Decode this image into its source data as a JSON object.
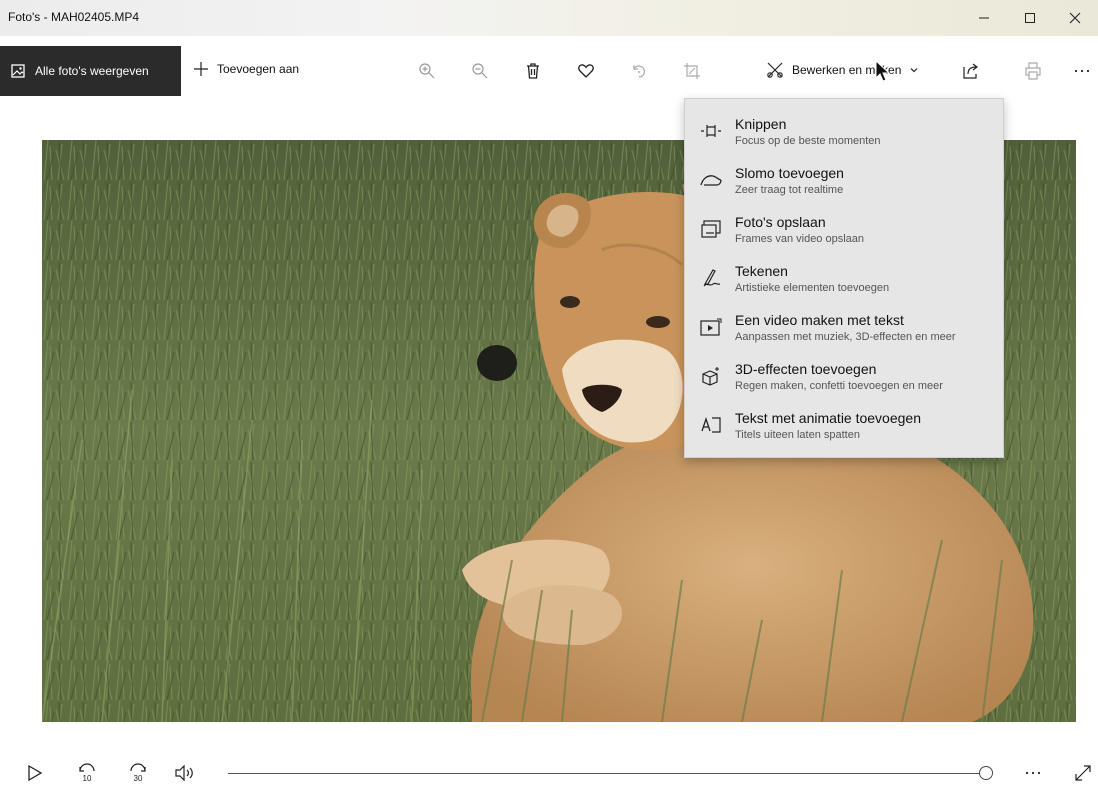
{
  "window": {
    "title": "Foto's - MAH02405.MP4",
    "controls": [
      "minimize-icon",
      "maximize-icon",
      "close-icon"
    ]
  },
  "toolbar": {
    "back_label": "Alle foto's weergeven",
    "add_label": "Toevoegen aan",
    "edit_label": "Bewerken en maken",
    "tools": [
      "zoom-in-icon",
      "zoom-out-icon",
      "trash-icon",
      "heart-icon",
      "rotate-icon",
      "crop-icon",
      "share-icon",
      "print-icon",
      "more-icon"
    ]
  },
  "edit_menu": {
    "items": [
      {
        "icon": "trim-icon",
        "title": "Knippen",
        "subtitle": "Focus op de beste momenten"
      },
      {
        "icon": "slowmo-icon",
        "title": "Slomo toevoegen",
        "subtitle": "Zeer traag tot realtime"
      },
      {
        "icon": "save-frame-icon",
        "title": "Foto's opslaan",
        "subtitle": "Frames van video opslaan"
      },
      {
        "icon": "draw-icon",
        "title": "Tekenen",
        "subtitle": "Artistieke elementen toevoegen"
      },
      {
        "icon": "video-text-icon",
        "title": "Een video maken met tekst",
        "subtitle": "Aanpassen met muziek, 3D-effecten en meer"
      },
      {
        "icon": "3d-effects-icon",
        "title": "3D-effecten toevoegen",
        "subtitle": "Regen maken, confetti toevoegen en meer"
      },
      {
        "icon": "animated-text-icon",
        "title": "Tekst met animatie toevoegen",
        "subtitle": "Titels uiteen laten spatten"
      }
    ]
  },
  "player": {
    "rewind_label": "10",
    "forward_label": "30",
    "progress": 0.99,
    "controls": [
      "play-icon",
      "rewind-10-icon",
      "forward-30-icon",
      "volume-icon",
      "more-icon",
      "fullscreen-icon"
    ]
  },
  "colors": {
    "back_button_bg": "#2b2b2b",
    "menu_bg": "#e6e6e6",
    "grass": "#5a6a3c",
    "lion": "#c49563"
  }
}
